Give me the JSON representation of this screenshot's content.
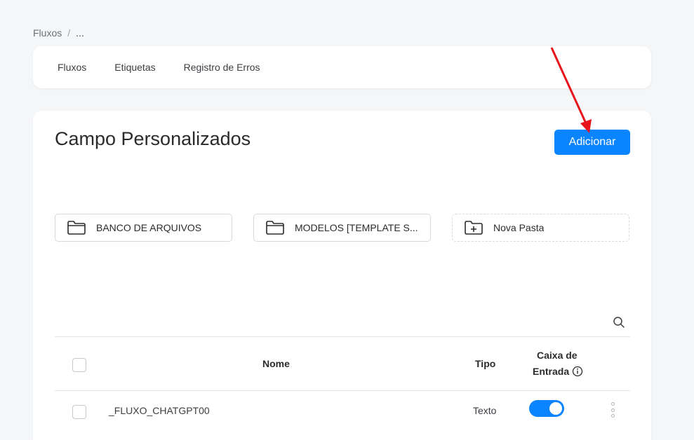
{
  "breadcrumb": {
    "root": "Fluxos",
    "separator": "/",
    "current": "..."
  },
  "tabs": [
    {
      "label": "Fluxos"
    },
    {
      "label": "Etiquetas"
    },
    {
      "label": "Registro de Erros"
    }
  ],
  "page": {
    "title": "Campo Personalizados",
    "add_label": "Adicionar"
  },
  "folders": [
    {
      "label": "BANCO DE ARQUIVOS",
      "icon": "folder-icon"
    },
    {
      "label": "MODELOS [TEMPLATE S...",
      "icon": "folder-icon"
    },
    {
      "label": "Nova Pasta",
      "icon": "folder-plus-icon"
    }
  ],
  "table": {
    "headers": {
      "name": "Nome",
      "type": "Tipo",
      "inbox_line1": "Caixa de",
      "inbox_line2": "Entrada"
    },
    "rows": [
      {
        "name": "_FLUXO_CHATGPT00",
        "type": "Texto",
        "inbox_enabled": true
      }
    ]
  },
  "colors": {
    "accent": "#0a84ff",
    "annotation_arrow": "#e8141b"
  }
}
